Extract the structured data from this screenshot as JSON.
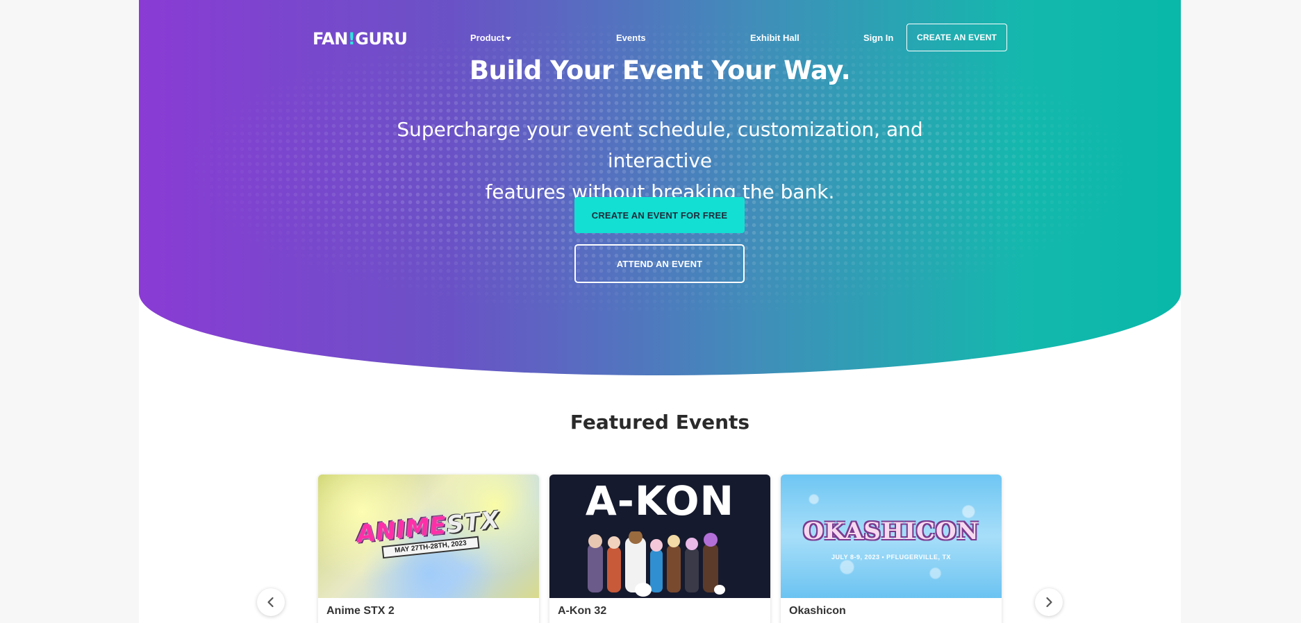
{
  "nav": {
    "logo_part1": "FAN",
    "logo_bang": "!",
    "logo_part2": "GURU",
    "product_label": "Product",
    "events_label": "Events",
    "exhibit_label": "Exhibit Hall",
    "signin_label": "Sign In",
    "cta_label": "CREATE AN EVENT"
  },
  "hero": {
    "title": "Build Your Event Your Way.",
    "subtitle_line1": "Supercharge your event schedule, customization, and interactive",
    "subtitle_line2": "features without breaking the bank.",
    "primary_button": "CREATE AN EVENT FOR FREE",
    "secondary_button": "ATTEND AN EVENT"
  },
  "featured": {
    "title": "Featured Events",
    "events": [
      {
        "name": "Anime STX 2",
        "logo_main": "ANIME",
        "logo_accent": "STX",
        "date_banner": "MAY 27TH-28TH, 2023"
      },
      {
        "name": "A-Kon 32",
        "logo": "A-KON"
      },
      {
        "name": "Okashicon",
        "logo": "OKASHICON",
        "date_banner": "JULY 8-9, 2023 • PFLUGERVILLE, TX"
      }
    ]
  },
  "colors": {
    "hero_gradient_start": "#8a3bd4",
    "hero_gradient_end": "#09b8a9",
    "primary_button": "#13dfd3",
    "logo_accent": "#2ee6dc"
  },
  "icons": {
    "prev": "chevron-left-icon",
    "next": "chevron-right-icon",
    "dropdown": "caret-down-icon"
  }
}
